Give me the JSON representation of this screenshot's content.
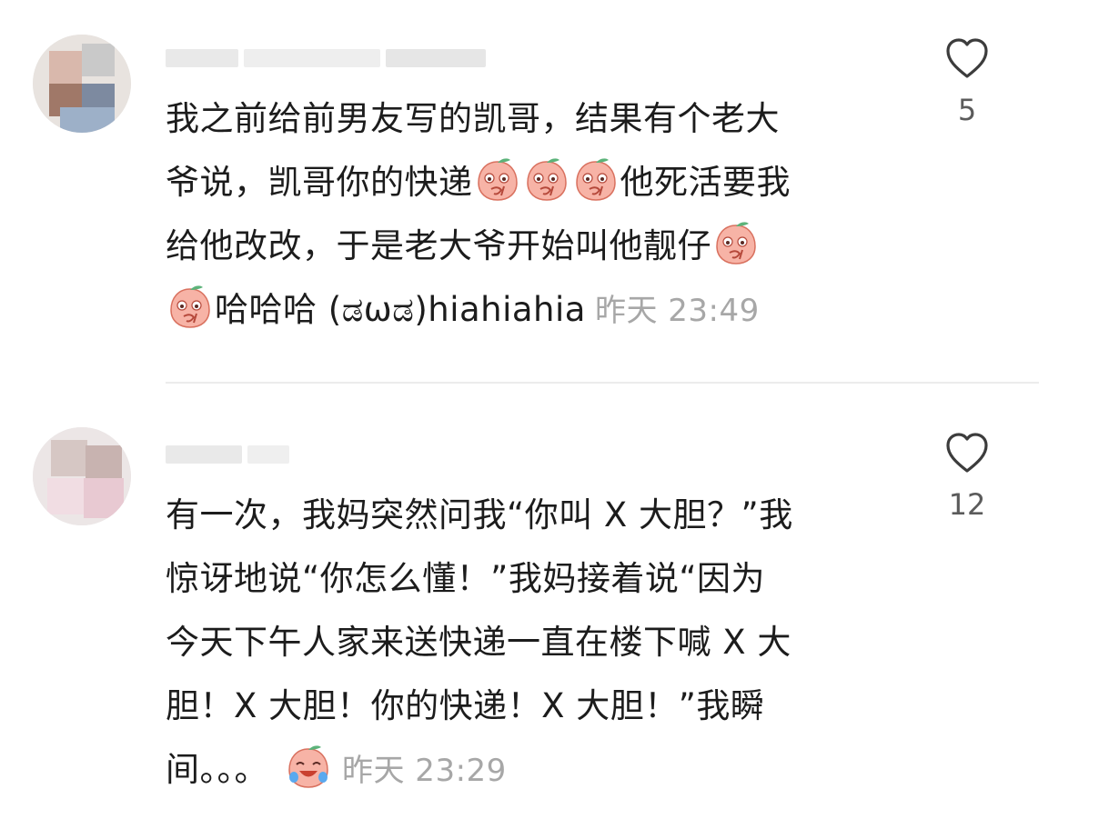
{
  "comments": [
    {
      "text_line1": "我之前给前男友写的凯哥，结果有个老大",
      "text_line2_a": "爷说，凯哥你的快递",
      "text_line2_b": "他死活要我",
      "text_line3": "给他改改，于是老大爷开始叫他靓仔",
      "text_line4": "哈哈哈 (ಡωಡ)hiahiahia",
      "time": "昨天 23:49",
      "likes": "5",
      "emoji": "blushing-peach-emoji"
    },
    {
      "text_line1": "有一次，我妈突然问我“你叫 X 大胆？”我",
      "text_line2": "惊讶地说“你怎么懂！”我妈接着说“因为",
      "text_line3": "今天下午人家来送快递一直在楼下喊 X 大",
      "text_line4": "胆！X 大胆！你的快递！X 大胆！”我瞬",
      "text_line5": "间。。。",
      "time": "昨天 23:29",
      "likes": "12",
      "emoji": "laughing-crying-peach-emoji"
    }
  ],
  "icons": {
    "like": "heart-outline-icon"
  },
  "colors": {
    "text": "#1c1c1c",
    "timestamp": "#a7a7a7",
    "like_count": "#5b5b5b",
    "divider": "#ececec",
    "emoji_pink": "#f6a79a"
  }
}
